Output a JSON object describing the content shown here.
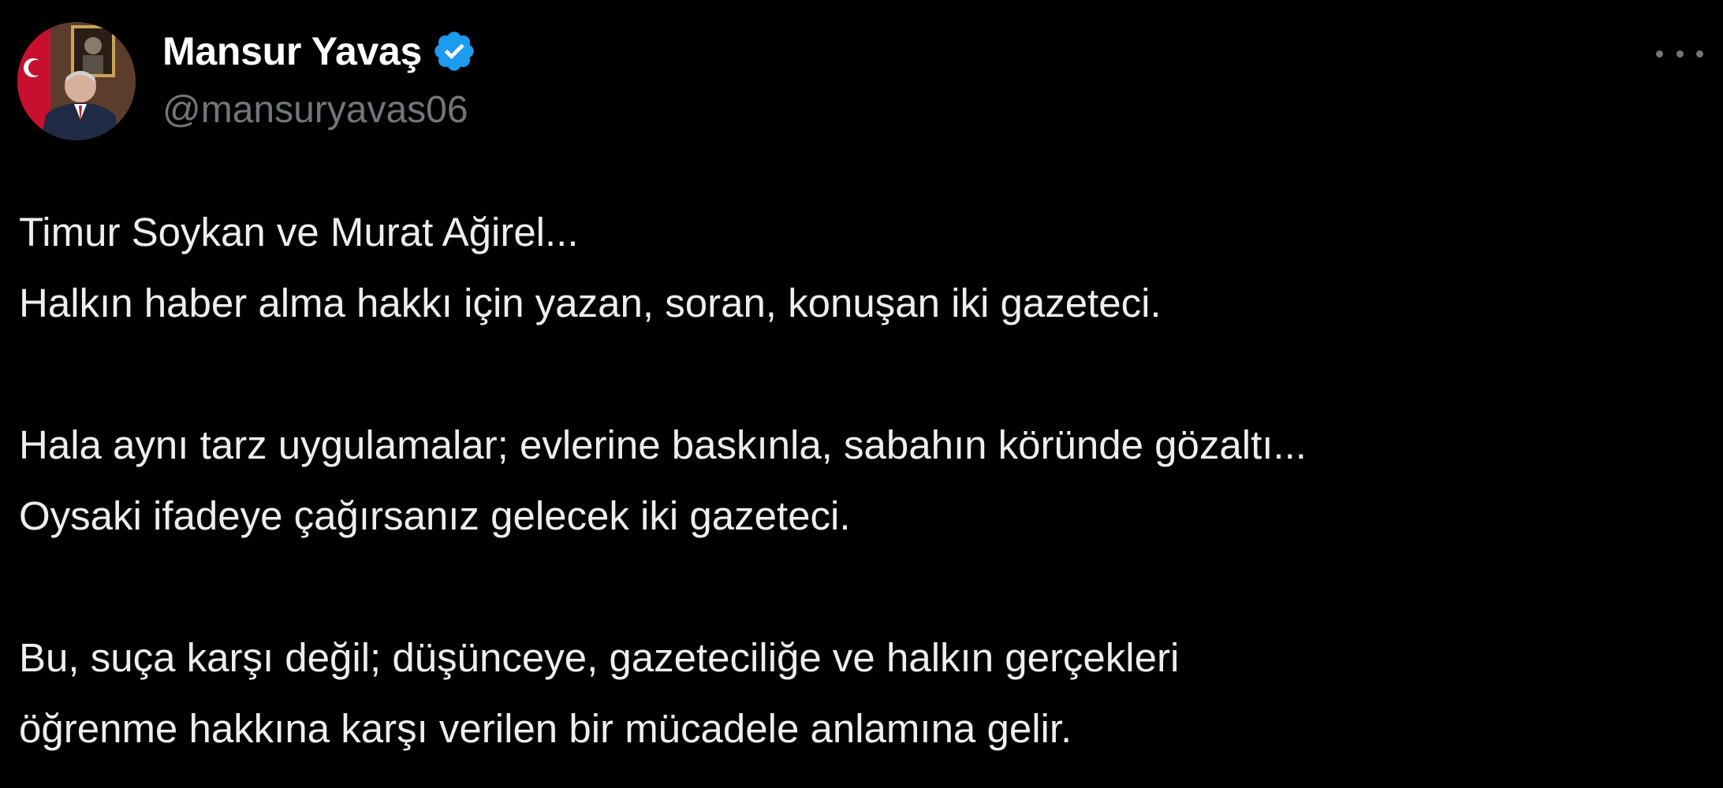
{
  "author": {
    "display_name": "Mansur Yavaş",
    "handle": "@mansuryavas06",
    "verified": true,
    "verified_color": "#1d9bf0",
    "avatar_icon": "profile-photo"
  },
  "menu": {
    "icon": "more-horizontal-icon"
  },
  "tweet": {
    "paragraphs": [
      {
        "lines": [
          "Timur Soykan ve Murat Ağirel...",
          "Halkın haber alma hakkı için yazan, soran, konuşan iki gazeteci."
        ]
      },
      {
        "lines": [
          "Hala aynı tarz uygulamalar; evlerine baskınla, sabahın köründe gözaltı...",
          "Oysaki ifadeye çağırsanız gelecek iki gazeteci."
        ]
      },
      {
        "lines": [
          "Bu, suça karşı değil; düşünceye, gazeteciliğe ve halkın gerçekleri",
          "öğrenme hakkına karşı verilen bir mücadele anlamına gelir."
        ]
      }
    ]
  },
  "colors": {
    "background": "#000000",
    "primary_text": "#e7e9ea",
    "secondary_text": "#71767b"
  }
}
